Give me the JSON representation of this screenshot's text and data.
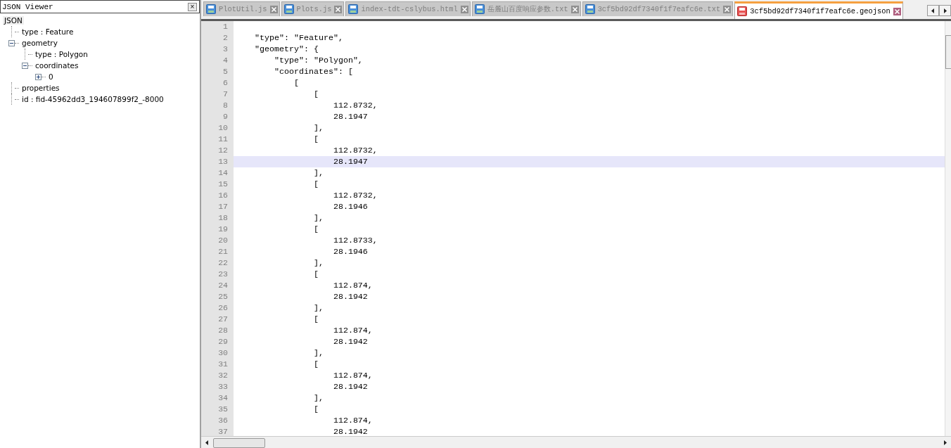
{
  "viewer": {
    "title": "JSON Viewer",
    "close": "×",
    "tree": [
      {
        "label": "JSON",
        "selected": true,
        "children": [
          {
            "label": "type : Feature",
            "selected": false
          },
          {
            "label": "geometry",
            "selected": false,
            "expanded": true,
            "children": [
              {
                "label": "type : Polygon",
                "selected": false
              },
              {
                "label": "coordinates",
                "selected": false,
                "expanded": true,
                "children": [
                  {
                    "label": "0",
                    "selected": false,
                    "expanded": false
                  }
                ]
              }
            ]
          },
          {
            "label": "properties",
            "selected": false
          },
          {
            "label": "id : fid-45962dd3_194607899f2_-8000",
            "selected": false
          }
        ]
      }
    ]
  },
  "tabs": [
    {
      "label": "PlotUtil.js",
      "selected": false
    },
    {
      "label": "Plots.js",
      "selected": false
    },
    {
      "label": "index-tdt-cslybus.html",
      "selected": false
    },
    {
      "label": "岳麓山百度响应参数.txt",
      "selected": false
    },
    {
      "label": "3cf5bd92df7340f1f7eafc6e.txt",
      "selected": false
    },
    {
      "label": "3cf5bd92df7340f1f7eafc6e.geojson",
      "selected": true
    }
  ],
  "editor": {
    "lines": [
      {
        "number": "1",
        "current": false
      },
      {
        "number": "2",
        "code": "    \"type\": \"Feature\",",
        "current": false
      },
      {
        "number": "3",
        "code": "    \"geometry\": {",
        "current": false
      },
      {
        "number": "4",
        "code": "        \"type\": \"Polygon\",",
        "current": false
      },
      {
        "number": "5",
        "code": "        \"coordinates\": [",
        "current": false
      },
      {
        "number": "6",
        "code": "            [",
        "current": false
      },
      {
        "number": "7",
        "code": "                [",
        "current": false
      },
      {
        "number": "8",
        "code": "                    112.8732,",
        "current": false
      },
      {
        "number": "9",
        "code": "                    28.1947",
        "current": false
      },
      {
        "number": "10",
        "code": "                ],",
        "current": false
      },
      {
        "number": "11",
        "code": "                [",
        "current": false
      },
      {
        "number": "12",
        "code": "                    112.8732,",
        "current": false
      },
      {
        "number": "13",
        "code": "                    28.1947",
        "current": true
      },
      {
        "number": "14",
        "code": "                ],",
        "current": false
      },
      {
        "number": "15",
        "code": "                [",
        "current": false
      },
      {
        "number": "16",
        "code": "                    112.8732,",
        "current": false
      },
      {
        "number": "17",
        "code": "                    28.1946",
        "current": false
      },
      {
        "number": "18",
        "code": "                ],",
        "current": false
      },
      {
        "number": "19",
        "code": "                [",
        "current": false
      },
      {
        "number": "20",
        "code": "                    112.8733,",
        "current": false
      },
      {
        "number": "21",
        "code": "                    28.1946",
        "current": false
      },
      {
        "number": "22",
        "code": "                ],",
        "current": false
      },
      {
        "number": "23",
        "code": "                [",
        "current": false
      },
      {
        "number": "24",
        "code": "                    112.874,",
        "current": false
      },
      {
        "number": "25",
        "code": "                    28.1942",
        "current": false
      },
      {
        "number": "26",
        "code": "                ],",
        "current": false
      },
      {
        "number": "27",
        "code": "                [",
        "current": false
      },
      {
        "number": "28",
        "code": "                    112.874,",
        "current": false
      },
      {
        "number": "29",
        "code": "                    28.1942",
        "current": false
      },
      {
        "number": "30",
        "code": "                ],",
        "current": false
      },
      {
        "number": "31",
        "code": "                [",
        "current": false
      },
      {
        "number": "32",
        "code": "                    112.874,",
        "current": false
      },
      {
        "number": "33",
        "code": "                    28.1942",
        "current": false
      },
      {
        "number": "34",
        "code": "                ],",
        "current": false
      },
      {
        "number": "35",
        "code": "                [",
        "current": false
      },
      {
        "number": "36",
        "code": "                    112.874,",
        "current": false
      },
      {
        "number": "37",
        "code": "                    28.1942",
        "current": false
      }
    ]
  }
}
